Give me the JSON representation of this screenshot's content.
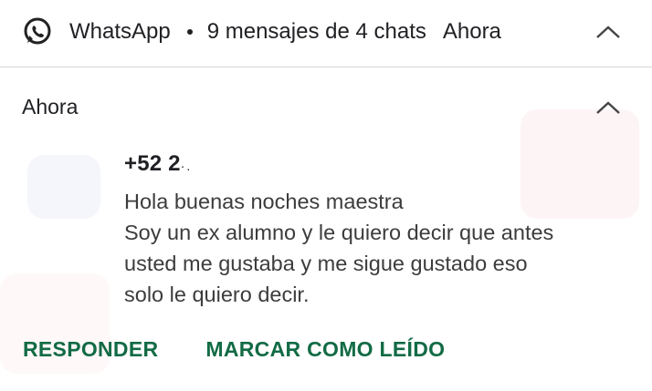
{
  "notification": {
    "app_name": "WhatsApp",
    "summary": "9 mensajes de 4 chats",
    "time": "Ahora"
  },
  "conversation": {
    "time": "Ahora",
    "sender": "+52 2",
    "sender_suffix": "·.",
    "message_lines": [
      "Hola buenas noches maestra",
      "Soy un ex alumno y le quiero decir que antes",
      "usted me gustaba y me sigue gustado eso",
      "solo le quiero decir."
    ]
  },
  "actions": {
    "reply_label": "RESPONDER",
    "mark_read_label": "MARCAR COMO LEÍDO"
  },
  "colors": {
    "whatsapp_brand": "#25D366",
    "action_text": "#126b45"
  },
  "icons": {
    "app": "whatsapp-icon",
    "collapse": "chevron-up-icon"
  }
}
